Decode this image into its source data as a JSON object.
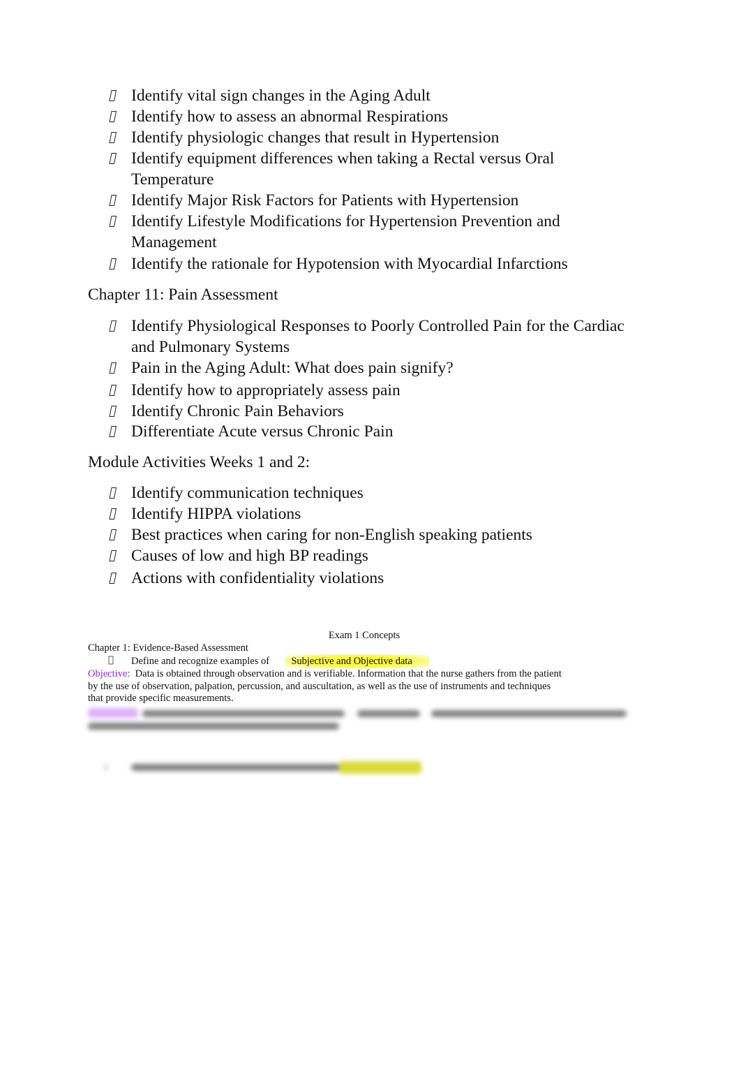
{
  "section_vital_signs": {
    "items": [
      {
        "lines": [
          "Identify vital sign changes in the Aging Adult"
        ]
      },
      {
        "lines": [
          "Identify how to assess an abnormal Respirations"
        ]
      },
      {
        "lines": [
          "Identify physiologic changes that result in Hypertension"
        ]
      },
      {
        "lines": [
          "Identify equipment differences when taking a Rectal versus Oral",
          "Temperature"
        ]
      },
      {
        "lines": [
          "Identify Major Risk Factors for Patients with Hypertension"
        ]
      },
      {
        "lines": [
          "Identify Lifestyle Modifications for Hypertension Prevention and",
          "Management"
        ]
      },
      {
        "lines": [
          "Identify the rationale for Hypotension with Myocardial Infarctions"
        ]
      }
    ]
  },
  "section_pain": {
    "heading": "Chapter 11: Pain Assessment",
    "items": [
      {
        "lines": [
          "Identify Physiological Responses to Poorly Controlled Pain for the Cardiac",
          "and Pulmonary Systems"
        ]
      },
      {
        "lines": [
          "Pain in the Aging Adult: What does pain signify?"
        ]
      },
      {
        "lines": [
          "Identify how to appropriately assess pain"
        ]
      },
      {
        "lines": [
          "Identify Chronic Pain Behaviors"
        ]
      },
      {
        "lines": [
          "Differentiate Acute versus Chronic Pain"
        ]
      }
    ]
  },
  "section_module": {
    "heading": "Module Activities Weeks 1 and 2:",
    "items": [
      {
        "lines": [
          "Identify communication techniques"
        ]
      },
      {
        "lines": [
          "Identify HIPPA violations"
        ]
      },
      {
        "lines": [
          "Best practices when caring for non-English speaking patients"
        ]
      },
      {
        "lines": [
          "Causes of low and high BP readings"
        ]
      },
      {
        "lines": [
          "Actions with confidentiality violations"
        ]
      }
    ]
  },
  "preview": {
    "title": "Exam 1 Concepts",
    "chapter": "Chapter 1: Evidence-Based Assessment",
    "bullet_text": "Define and recognize examples of",
    "bullet_highlight": "Subjective and Objective data",
    "objective_label": "Objective:",
    "objective_lines": [
      "Data is obtained through observation and is verifiable. Information that the nurse gathers from the patient",
      "by the use of observation, palpation, percussion, and auscultation, as well as the use of instruments and techniques",
      "that provide specific measurements."
    ]
  },
  "colors": {
    "highlight_yellow": "#f7f53a",
    "label_purple": "#9b1fd6"
  }
}
